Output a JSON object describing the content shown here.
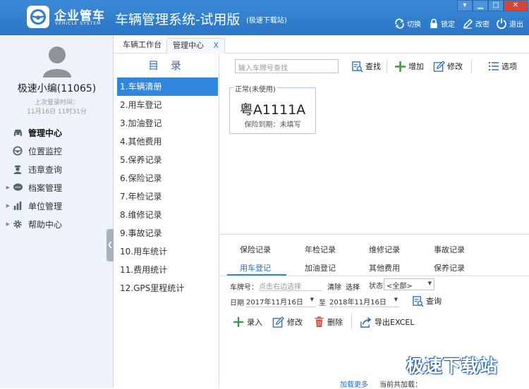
{
  "titlebar": {
    "brand_name": "企业管车",
    "brand_sub": "VEHICLE SYSTEM",
    "app_title": "车辆管理系统-试用版",
    "app_subtitle": "(极速下载站)",
    "actions": [
      {
        "label": "切换",
        "icon": "switch-icon"
      },
      {
        "label": "锁定",
        "icon": "lock-icon"
      },
      {
        "label": "改密",
        "icon": "edit-password-icon"
      },
      {
        "label": "退出",
        "icon": "power-icon"
      }
    ],
    "window_controls": {
      "menu": "▾",
      "minimize": "▁",
      "maximize": "□",
      "close": "✕"
    }
  },
  "user": {
    "name": "极速小编(11065)",
    "last_login_label": "上次登录时间：",
    "last_login_time": "11月16日 11时31分"
  },
  "nav": [
    {
      "label": "管理中心",
      "icon": "car-icon",
      "active": true,
      "expandable": false
    },
    {
      "label": "位置监控",
      "icon": "steering-wheel-icon",
      "active": false,
      "expandable": false
    },
    {
      "label": "违章查询",
      "icon": "police-icon",
      "active": false,
      "expandable": false
    },
    {
      "label": "档案管理",
      "icon": "chat-bubble-icon",
      "active": false,
      "expandable": true
    },
    {
      "label": "单位管理",
      "icon": "bar-chart-icon",
      "active": false,
      "expandable": true
    },
    {
      "label": "帮助中心",
      "icon": "gear-icon",
      "active": false,
      "expandable": true
    }
  ],
  "tabs": [
    {
      "label": "车辆工作台",
      "active": false
    },
    {
      "label": "管理中心",
      "active": true,
      "close": "X"
    }
  ],
  "directory": {
    "title": "目 录",
    "items": [
      "1.车辆清册",
      "2.用车登记",
      "3.加油登记",
      "4.其他费用",
      "5.保养记录",
      "6.保险记录",
      "7.年检记录",
      "8.维修记录",
      "9.事故记录",
      "10.用车统计",
      "11.费用统计",
      "12.GPS里程统计"
    ]
  },
  "toolbar": {
    "search_placeholder": "输入车牌号查找",
    "find_label": "查找",
    "add_label": "增加",
    "modify_label": "修改",
    "options_label": "选项"
  },
  "vehicle_card": {
    "status": "正常(未使用)",
    "plate": "粤A1111A",
    "insurance": "保险到期：未填写"
  },
  "subtabs": {
    "row1": [
      "保险记录",
      "年检记录",
      "维修记录",
      "事故记录"
    ],
    "row2": [
      "用车登记",
      "加油登记",
      "其他费用",
      "保养记录"
    ],
    "active": "用车登记"
  },
  "filters": {
    "plate_label": "车牌号：",
    "plate_placeholder": "点击右边选择",
    "clear_label": "清除",
    "choose_label": "选择",
    "status_label": "状态",
    "status_value": "<全部>",
    "date_label": "日期",
    "date_from": "2017年11月16日",
    "date_to_label": "至",
    "date_to": "2018年11月16日",
    "query_label": "查询"
  },
  "actions": {
    "enter_label": "录入",
    "modify_label": "修改",
    "delete_label": "删除",
    "export_label": "导出EXCEL"
  },
  "footer": {
    "load_more": "加载更多",
    "loaded_label": "当前共加载："
  },
  "watermark": "极速下载站",
  "colors": {
    "titlebar": "#2f7fd0",
    "accent": "#2f86dc",
    "add_green": "#2e9e3e",
    "delete_red": "#d64535"
  }
}
